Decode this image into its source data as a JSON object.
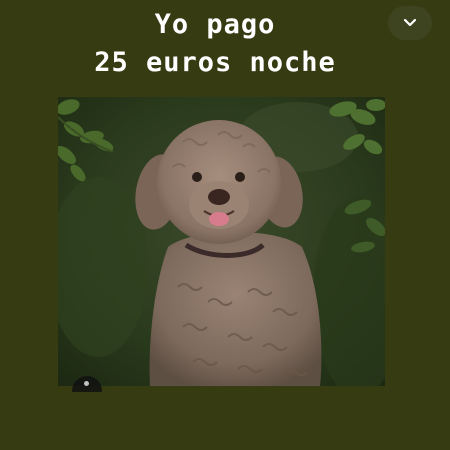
{
  "caption": {
    "line1": "Yo pago",
    "line2": "25 euros noche"
  },
  "controls": {
    "dropdown_icon": "chevron-down-icon"
  },
  "photo": {
    "subject": "dog-photo"
  },
  "colors": {
    "background": "#363b11",
    "text": "#ffffff",
    "fur": "#8a7466",
    "foliage": "#3e5a26"
  }
}
